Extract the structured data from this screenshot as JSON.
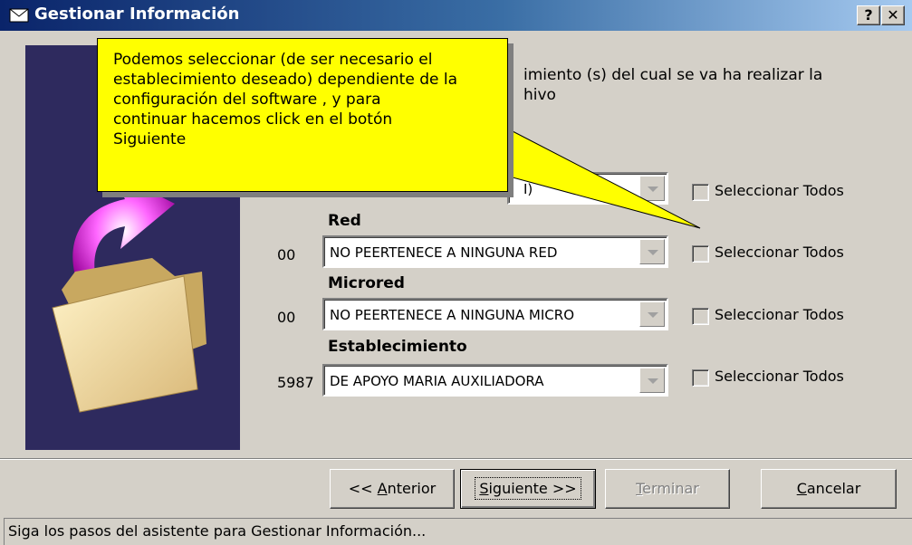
{
  "window": {
    "title": "Gestionar Información",
    "help_btn": "?",
    "close_btn": "✕"
  },
  "description": "imiento (s) del cual se va ha realizar la\nhivo",
  "sections": {
    "first_combo_partial": "I)",
    "red_label": "Red",
    "red_code": "00",
    "red_value": "NO PEERTENECE A NINGUNA RED",
    "microred_label": "Microred",
    "microred_code": "00",
    "microred_value": "NO PEERTENECE A NINGUNA MICRO",
    "establecimiento_label": "Establecimiento",
    "establecimiento_code": "5987",
    "establecimiento_value": "DE APOYO MARIA AUXILIADORA"
  },
  "checkbox_label": "Seleccionar Todos",
  "buttons": {
    "anterior_prefix": "<< ",
    "anterior_u": "A",
    "anterior_rest": "nterior",
    "siguiente_u": "S",
    "siguiente_rest": "iguiente >>",
    "terminar_u": "T",
    "terminar_rest": "erminar",
    "cancelar_u": "C",
    "cancelar_rest": "ancelar"
  },
  "status": "Siga los pasos del asistente para Gestionar Información...",
  "callout": "Podemos seleccionar (de ser necesario el\nestablecimiento deseado) dependiente de la\nconfiguración del software , y para\ncontinuar hacemos click en el botón\nSiguiente"
}
